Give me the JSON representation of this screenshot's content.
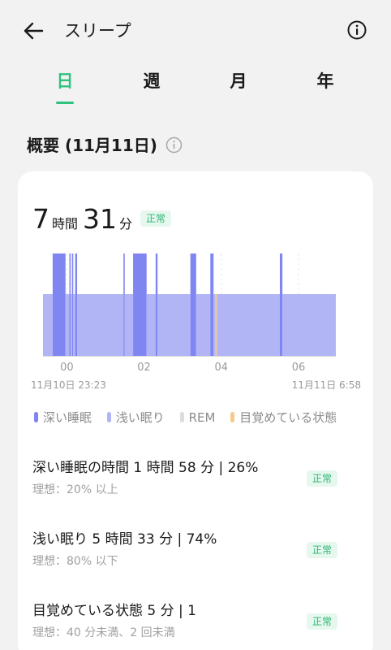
{
  "header": {
    "title": "スリープ",
    "back_icon": "arrow-left-icon",
    "info_icon": "info-icon"
  },
  "tabs": [
    {
      "label": "日",
      "active": true
    },
    {
      "label": "週",
      "active": false
    },
    {
      "label": "月",
      "active": false
    },
    {
      "label": "年",
      "active": false
    }
  ],
  "summary": {
    "title": "概要 (11月11日)",
    "hours": "7",
    "hours_unit": "時間",
    "minutes": "31",
    "minutes_unit": "分",
    "status": "正常"
  },
  "chart_data": {
    "type": "bar",
    "x_ticks": [
      "00",
      "02",
      "04",
      "06"
    ],
    "start_label": "11月10日 23:23",
    "end_label": "11月11日 6:58",
    "stages": [
      {
        "stage": "light",
        "start": "23:23",
        "end": "23:38"
      },
      {
        "stage": "deep",
        "start": "23:38",
        "end": "23:58"
      },
      {
        "stage": "light",
        "start": "23:58",
        "end": "00:04"
      },
      {
        "stage": "deep",
        "start": "00:04",
        "end": "00:06"
      },
      {
        "stage": "light",
        "start": "00:06",
        "end": "00:08"
      },
      {
        "stage": "deep",
        "start": "00:08",
        "end": "00:10"
      },
      {
        "stage": "light",
        "start": "00:10",
        "end": "00:13"
      },
      {
        "stage": "deep",
        "start": "00:13",
        "end": "00:16"
      },
      {
        "stage": "light",
        "start": "00:16",
        "end": "01:28"
      },
      {
        "stage": "deep",
        "start": "01:28",
        "end": "01:30"
      },
      {
        "stage": "light",
        "start": "01:30",
        "end": "01:43"
      },
      {
        "stage": "deep",
        "start": "01:43",
        "end": "02:04"
      },
      {
        "stage": "light",
        "start": "02:04",
        "end": "02:18"
      },
      {
        "stage": "deep",
        "start": "02:18",
        "end": "02:21"
      },
      {
        "stage": "light",
        "start": "02:21",
        "end": "03:12"
      },
      {
        "stage": "deep",
        "start": "03:12",
        "end": "03:21"
      },
      {
        "stage": "light",
        "start": "03:21",
        "end": "03:43"
      },
      {
        "stage": "deep",
        "start": "03:43",
        "end": "03:48"
      },
      {
        "stage": "light",
        "start": "03:48",
        "end": "03:51"
      },
      {
        "stage": "awake",
        "start": "03:51",
        "end": "03:53"
      },
      {
        "stage": "light",
        "start": "03:53",
        "end": "05:31"
      },
      {
        "stage": "deep",
        "start": "05:31",
        "end": "05:35"
      },
      {
        "stage": "light",
        "start": "05:35",
        "end": "06:58"
      }
    ]
  },
  "legend": [
    {
      "label": "深い睡眠",
      "color": "#7f86f2"
    },
    {
      "label": "浅い眠り",
      "color": "#b1b5f6"
    },
    {
      "label": "REM",
      "color": "#dcdcdc"
    },
    {
      "label": "目覚めている状態",
      "color": "#f5c98a"
    }
  ],
  "stats": [
    {
      "title": "深い睡眠の時間 1 時間 58 分 | 26%",
      "ideal": "理想：20% 以上",
      "status": "正常"
    },
    {
      "title": "浅い眠り 5 時間 33 分 | 74%",
      "ideal": "理想：80% 以下",
      "status": "正常"
    },
    {
      "title": "目覚めている状態 5 分 | 1",
      "ideal": "理想：40 分未満、2 回未満",
      "status": "正常"
    }
  ],
  "colors": {
    "accent": "#2ec27e",
    "deep": "#7f86f2",
    "light": "#b1b5f6",
    "awake": "#f5c98a",
    "rem": "#dcdcdc"
  }
}
